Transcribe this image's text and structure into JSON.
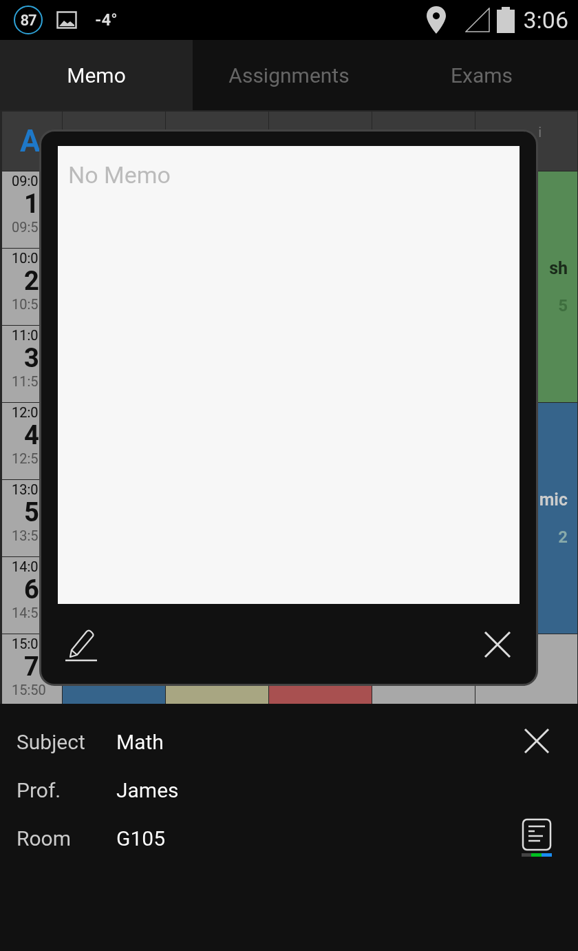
{
  "status_bar": {
    "badge": "87",
    "temperature": "-4°",
    "time": "3:06"
  },
  "tabs": [
    {
      "label": "Memo",
      "selected": true
    },
    {
      "label": "Assignments",
      "selected": false
    },
    {
      "label": "Exams",
      "selected": false
    }
  ],
  "timetable": {
    "corner": "A",
    "last_header": "i",
    "periods": [
      {
        "start": "09:0",
        "number": "1",
        "end": "09:5"
      },
      {
        "start": "10:0",
        "number": "2",
        "end": "10:5"
      },
      {
        "start": "11:0",
        "number": "3",
        "end": "11:5"
      },
      {
        "start": "12:0",
        "number": "4",
        "end": "12:5"
      },
      {
        "start": "13:0",
        "number": "5",
        "end": "13:5"
      },
      {
        "start": "14:0",
        "number": "6",
        "end": "14:5"
      },
      {
        "start": "15:0",
        "number": "7",
        "end": "15:50"
      }
    ],
    "last_column": [
      {
        "color": "#568a55",
        "title": "sh",
        "room": "5",
        "dark_text": true
      },
      {
        "color": "#36648b",
        "title": "mic",
        "room": "2",
        "dark_text": false
      },
      {
        "color": "#a8a8a8"
      }
    ],
    "bottom_row": [
      {
        "color": "#36648b"
      },
      {
        "color": "#a8a682"
      },
      {
        "color": "#a85050"
      },
      {
        "color": "#a8a8a8"
      }
    ]
  },
  "memo_dialog": {
    "placeholder": "No Memo"
  },
  "details": [
    {
      "label": "Subject",
      "value": "Math"
    },
    {
      "label": "Prof.",
      "value": "James"
    },
    {
      "label": "Room",
      "value": "G105"
    }
  ]
}
